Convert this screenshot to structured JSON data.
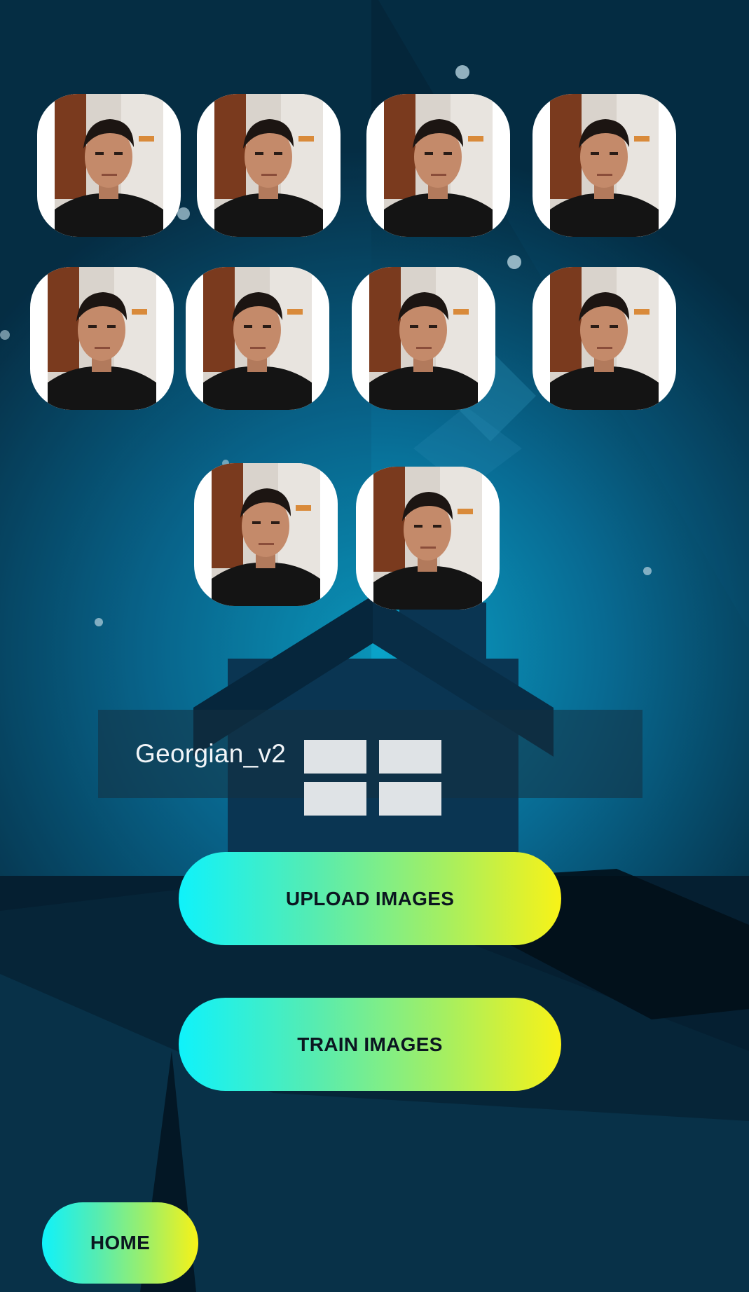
{
  "colors": {
    "background_dark": "#04263a",
    "background_glow": "#0aa3c9",
    "button_gradient_start": "#0ff2fb",
    "button_gradient_end": "#f8f217",
    "button_text": "#0b1620",
    "thumbnail_frame": "#ffffff"
  },
  "gallery": {
    "images": [
      {
        "icon": "face-photo"
      },
      {
        "icon": "face-photo"
      },
      {
        "icon": "face-photo"
      },
      {
        "icon": "face-photo"
      },
      {
        "icon": "face-photo"
      },
      {
        "icon": "face-photo"
      },
      {
        "icon": "face-photo"
      },
      {
        "icon": "face-photo"
      },
      {
        "icon": "face-photo"
      },
      {
        "icon": "face-photo"
      }
    ]
  },
  "profile": {
    "name": "Georgian_v2",
    "icon": "window-grid-icon"
  },
  "actions": {
    "upload_label": "UPLOAD IMAGES",
    "train_label": "TRAIN IMAGES",
    "home_label": "HOME"
  }
}
